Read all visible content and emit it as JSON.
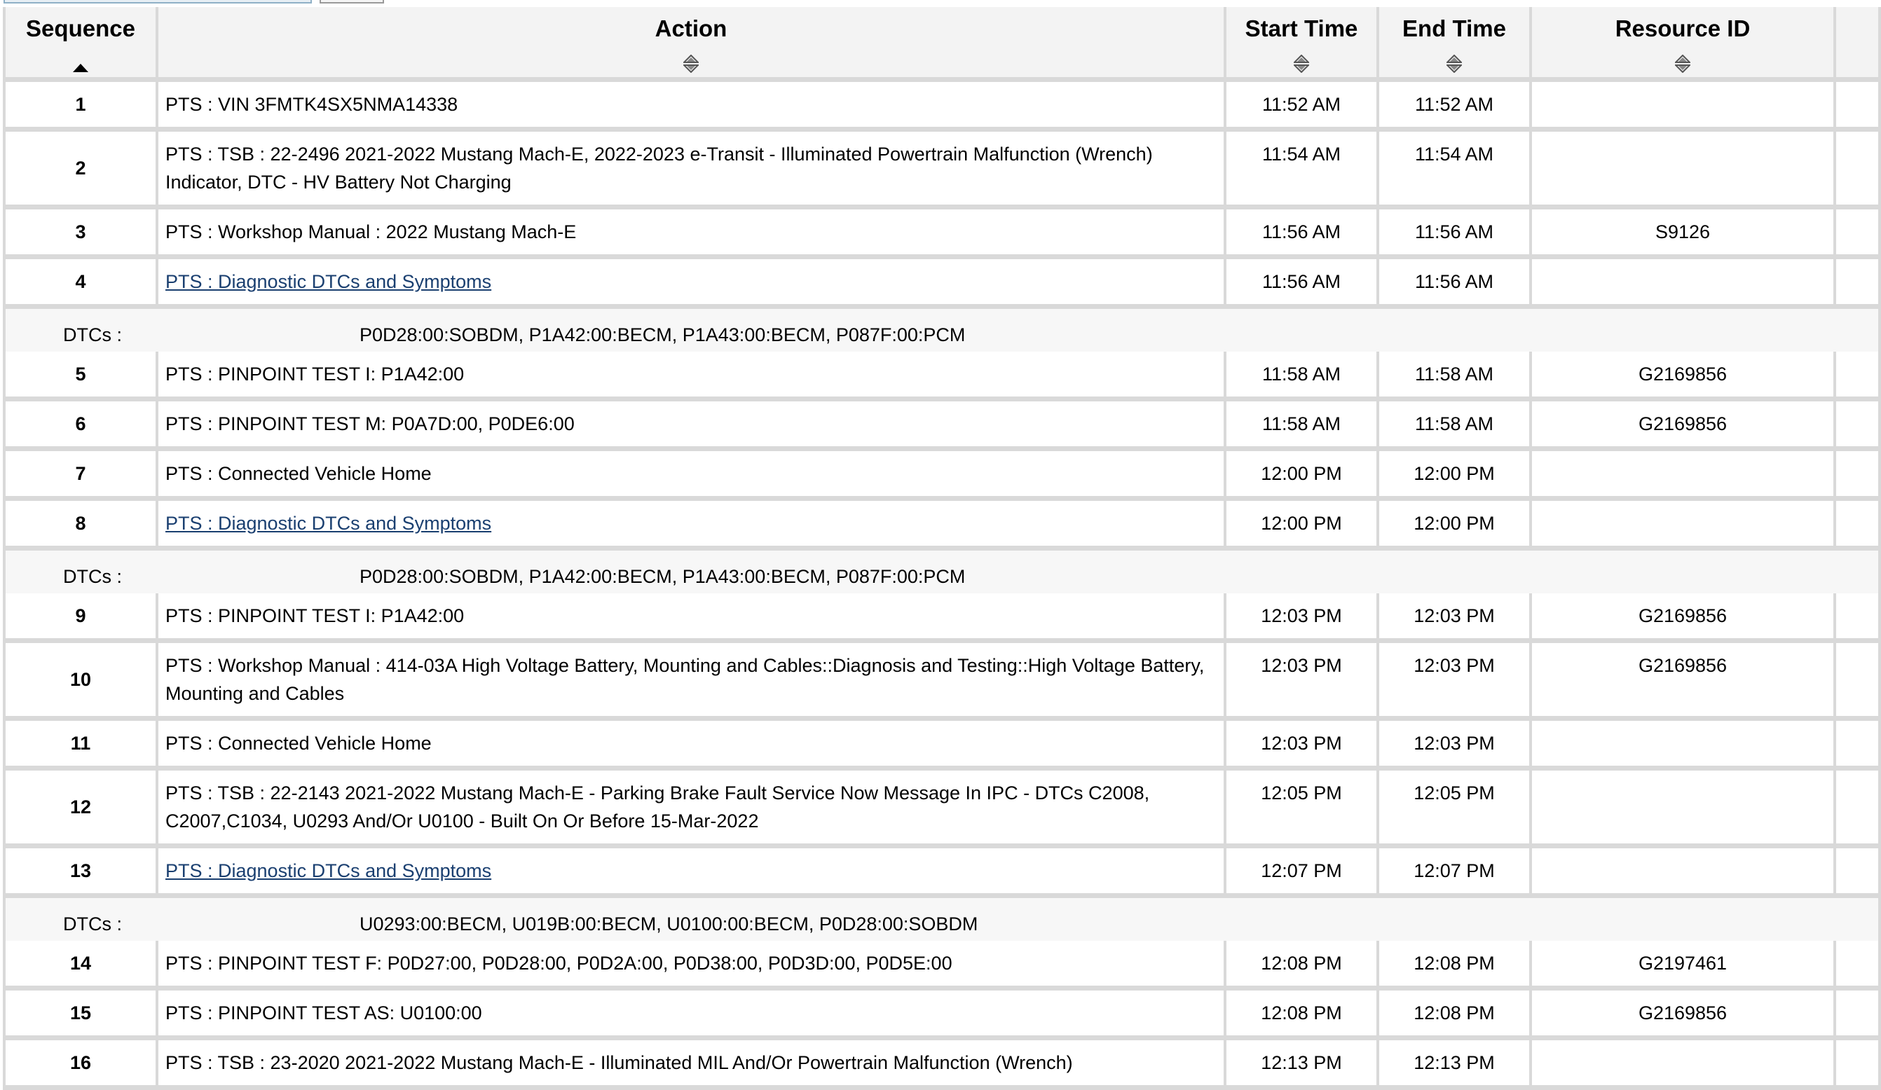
{
  "columns": {
    "sequence": "Sequence",
    "action": "Action",
    "start_time": "Start Time",
    "end_time": "End Time",
    "resource_id": "Resource ID"
  },
  "dtc_label": "DTCs :",
  "rows": [
    {
      "seq": "1",
      "action": "PTS : VIN 3FMTK4SX5NMA14338",
      "start": "11:52 AM",
      "end": "11:52 AM",
      "resource": ""
    },
    {
      "seq": "2",
      "action": "PTS : TSB : 22-2496 2021-2022 Mustang Mach-E, 2022-2023 e-Transit - Illuminated Powertrain Malfunction (Wrench) Indicator, DTC - HV Battery Not Charging",
      "start": "11:54 AM",
      "end": "11:54 AM",
      "resource": ""
    },
    {
      "seq": "3",
      "action": "PTS : Workshop Manual : 2022 Mustang Mach-E",
      "start": "11:56 AM",
      "end": "11:56 AM",
      "resource": "S9126"
    },
    {
      "seq": "4",
      "action": "PTS : Diagnostic DTCs and Symptoms",
      "start": "11:56 AM",
      "end": "11:56 AM",
      "resource": ""
    },
    {
      "seq": "5",
      "action": "PTS : PINPOINT TEST I: P1A42:00",
      "start": "11:58 AM",
      "end": "11:58 AM",
      "resource": "G2169856"
    },
    {
      "seq": "6",
      "action": "PTS : PINPOINT TEST M: P0A7D:00, P0DE6:00",
      "start": "11:58 AM",
      "end": "11:58 AM",
      "resource": "G2169856"
    },
    {
      "seq": "7",
      "action": "PTS : Connected Vehicle Home",
      "start": "12:00 PM",
      "end": "12:00 PM",
      "resource": ""
    },
    {
      "seq": "8",
      "action": "PTS : Diagnostic DTCs and Symptoms",
      "start": "12:00 PM",
      "end": "12:00 PM",
      "resource": ""
    },
    {
      "seq": "9",
      "action": "PTS : PINPOINT TEST I: P1A42:00",
      "start": "12:03 PM",
      "end": "12:03 PM",
      "resource": "G2169856"
    },
    {
      "seq": "10",
      "action": "PTS : Workshop Manual : 414-03A High Voltage Battery, Mounting and Cables::Diagnosis and Testing::High Voltage Battery, Mounting and Cables",
      "start": "12:03 PM",
      "end": "12:03 PM",
      "resource": "G2169856"
    },
    {
      "seq": "11",
      "action": "PTS : Connected Vehicle Home",
      "start": "12:03 PM",
      "end": "12:03 PM",
      "resource": ""
    },
    {
      "seq": "12",
      "action": "PTS : TSB : 22-2143 2021-2022 Mustang Mach-E - Parking Brake Fault Service Now Message In IPC - DTCs C2008, C2007,C1034, U0293 And/Or U0100 - Built On Or Before 15-Mar-2022",
      "start": "12:05 PM",
      "end": "12:05 PM",
      "resource": ""
    },
    {
      "seq": "13",
      "action": "PTS : Diagnostic DTCs and Symptoms",
      "start": "12:07 PM",
      "end": "12:07 PM",
      "resource": ""
    },
    {
      "seq": "14",
      "action": "PTS : PINPOINT TEST F: P0D27:00, P0D28:00, P0D2A:00, P0D38:00, P0D3D:00, P0D5E:00",
      "start": "12:08 PM",
      "end": "12:08 PM",
      "resource": "G2197461"
    },
    {
      "seq": "15",
      "action": "PTS : PINPOINT TEST AS: U0100:00",
      "start": "12:08 PM",
      "end": "12:08 PM",
      "resource": "G2169856"
    },
    {
      "seq": "16",
      "action": "PTS : TSB : 23-2020 2021-2022 Mustang Mach-E - Illuminated MIL And/Or Powertrain Malfunction (Wrench)",
      "start": "12:13 PM",
      "end": "12:13 PM",
      "resource": ""
    }
  ],
  "dtc_groups": [
    {
      "codes": "P0D28:00:SOBDM, P1A42:00:BECM, P1A43:00:BECM, P087F:00:PCM"
    },
    {
      "codes": "P0D28:00:SOBDM, P1A42:00:BECM, P1A43:00:BECM, P087F:00:PCM"
    },
    {
      "codes": "U0293:00:BECM, U019B:00:BECM, U0100:00:BECM, P0D28:00:SOBDM"
    }
  ]
}
